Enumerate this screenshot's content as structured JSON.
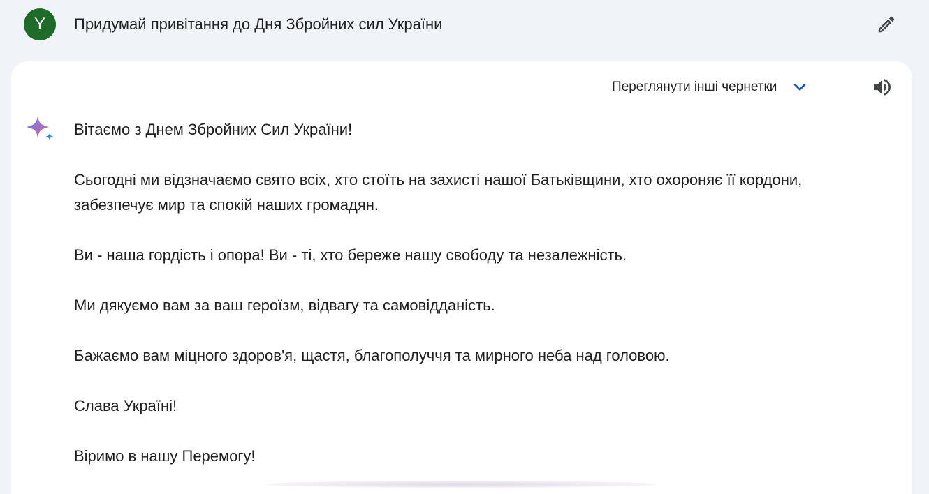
{
  "prompt": {
    "avatar_initial": "Y",
    "avatar_color": "#1e6b2a",
    "text": "Придумай привітання до Дня Збройних сил України",
    "edit_icon": "pencil-icon"
  },
  "response": {
    "drafts_label": "Переглянути інші чернетки",
    "drafts_icon": "chevron-down-icon",
    "drafts_icon_color": "#0b57d0",
    "speaker_icon": "volume-icon",
    "assistant_icon": "sparkle-icon",
    "paragraphs": [
      "Вітаємо з Днем Збройних Сил України!",
      "Сьогодні ми відзначаємо свято всіх, хто стоїть на захисті нашої Батьківщини, хто охороняє її кордони, забезпечує мир та спокій наших громадян.",
      "Ви - наша гордість і опора! Ви - ті, хто береже нашу свободу та незалежність.",
      "Ми дякуємо вам за ваш героїзм, відвагу та самовідданість.",
      "Бажаємо вам міцного здоров'я, щастя, благополуччя та мирного неба над головою.",
      "Слава Україні!",
      "Віримо в нашу Перемогу!"
    ]
  }
}
